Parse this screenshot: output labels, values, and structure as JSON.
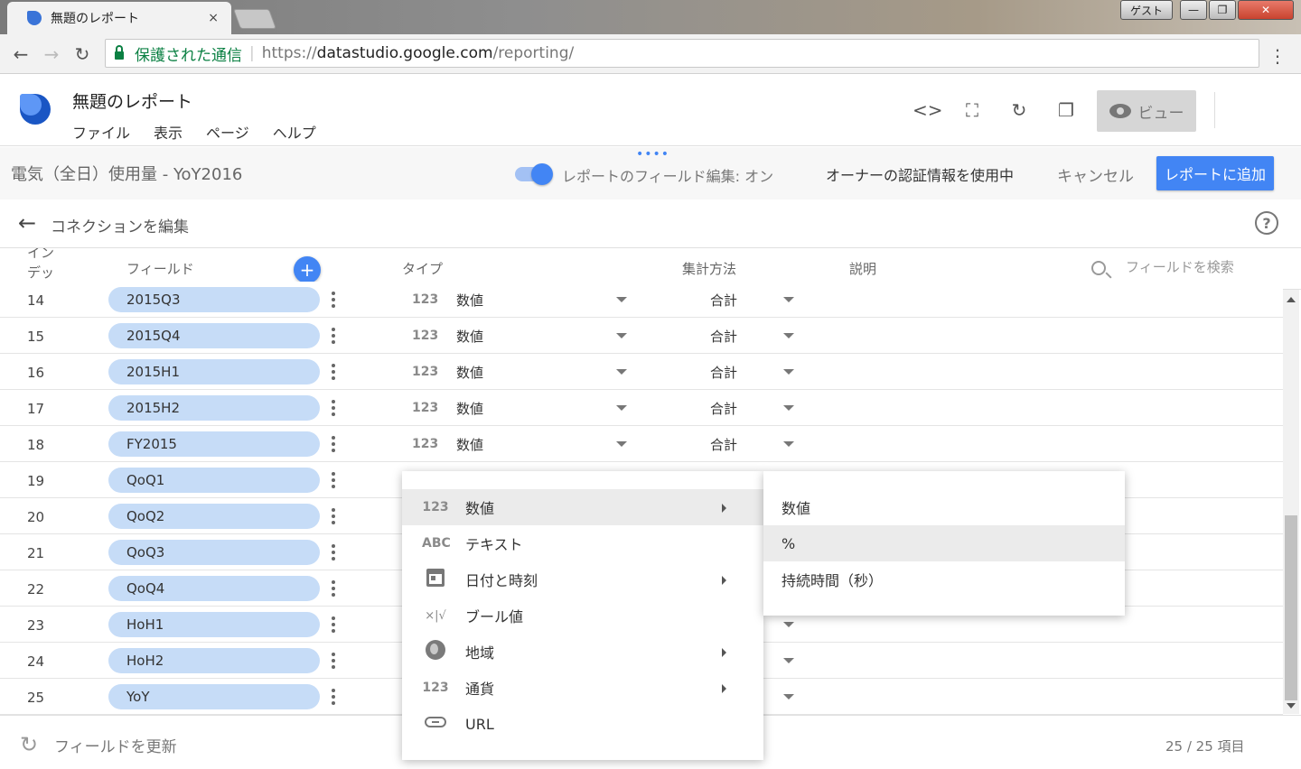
{
  "browser": {
    "tab_title": "無題のレポート",
    "tab_close": "×",
    "guest_label": "ゲスト",
    "win_min": "—",
    "win_max": "❐",
    "win_close": "✕",
    "back": "←",
    "forward": "→",
    "reload": "↻",
    "secure_label": "保護された通信",
    "url_scheme": "https://",
    "url_host": "datastudio.google.com",
    "url_path": "/reporting/",
    "menu": "⋮"
  },
  "app": {
    "doc_title": "無題のレポート",
    "menus": [
      "ファイル",
      "表示",
      "ページ",
      "ヘルプ"
    ],
    "toolbar": {
      "embed": "<>",
      "fullscreen": "⛶",
      "refresh": "↻",
      "copy": "❐"
    },
    "view_label": "ビュー"
  },
  "datasource": {
    "drag_handle": "••••",
    "name": "電気（全日）使用量 - YoY2016",
    "field_edit_label": "レポートのフィールド編集: オン",
    "field_edit_on": true,
    "owner_credentials": "オーナーの認証情報を使用中",
    "cancel": "キャンセル",
    "add_to_report": "レポートに追加"
  },
  "connection": {
    "back": "←",
    "title": "コネクションを編集",
    "help": "?"
  },
  "columns": {
    "index": "インデックス",
    "field": "フィールド",
    "add": "+",
    "type": "タイプ",
    "aggregation": "集計方法",
    "description": "説明",
    "search_placeholder": "フィールドを検索"
  },
  "rows": [
    {
      "index": "14",
      "field": "2015Q3",
      "type_icon": "123",
      "type": "数値",
      "aggregation": "合計"
    },
    {
      "index": "15",
      "field": "2015Q4",
      "type_icon": "123",
      "type": "数値",
      "aggregation": "合計"
    },
    {
      "index": "16",
      "field": "2015H1",
      "type_icon": "123",
      "type": "数値",
      "aggregation": "合計"
    },
    {
      "index": "17",
      "field": "2015H2",
      "type_icon": "123",
      "type": "数値",
      "aggregation": "合計"
    },
    {
      "index": "18",
      "field": "FY2015",
      "type_icon": "123",
      "type": "数値",
      "aggregation": "合計"
    },
    {
      "index": "19",
      "field": "QoQ1"
    },
    {
      "index": "20",
      "field": "QoQ2"
    },
    {
      "index": "21",
      "field": "QoQ3"
    },
    {
      "index": "22",
      "field": "QoQ4"
    },
    {
      "index": "23",
      "field": "HoH1"
    },
    {
      "index": "24",
      "field": "HoH2"
    },
    {
      "index": "25",
      "field": "YoY"
    }
  ],
  "type_menu": [
    {
      "icon": "123",
      "label": "数値",
      "submenu": true,
      "active": true
    },
    {
      "icon": "ABC",
      "label": "テキスト",
      "submenu": false
    },
    {
      "icon": "calendar-icon",
      "label": "日付と時刻",
      "submenu": true
    },
    {
      "icon": "×|√",
      "label": "ブール値",
      "submenu": false
    },
    {
      "icon": "globe-icon",
      "label": "地域",
      "submenu": true
    },
    {
      "icon": "123",
      "label": "通貨",
      "submenu": true
    },
    {
      "icon": "link-icon",
      "label": "URL",
      "submenu": false
    }
  ],
  "number_submenu": [
    {
      "label": "数値"
    },
    {
      "label": "%",
      "active": true
    },
    {
      "label": "持続時間（秒）"
    }
  ],
  "footer": {
    "refresh_icon": "↻",
    "refresh_label": "フィールドを更新",
    "count": "25 / 25 項目"
  },
  "colors": {
    "accent": "#4285f4",
    "chip": "#c6dcf7",
    "secure": "#0b8043"
  }
}
